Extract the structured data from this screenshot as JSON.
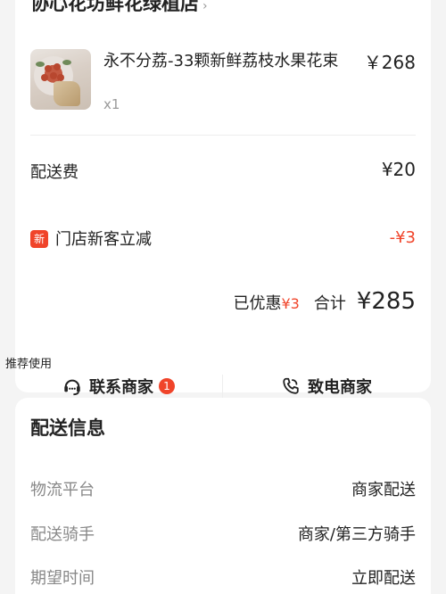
{
  "shop": {
    "name": "协心花坊鲜花绿植店",
    "chevron": "›"
  },
  "item": {
    "name": "永不分荔-33颗新鲜荔枝水果花束",
    "price": "￥268",
    "qty": "x1"
  },
  "fees": {
    "delivery_label": "配送费",
    "delivery_value": "¥20",
    "new_badge": "新",
    "discount_label": "门店新客立减",
    "discount_value": "-¥3"
  },
  "total": {
    "saved_label": "已优惠",
    "saved_value": "¥3",
    "sum_label": "合计",
    "sum_value": "¥285"
  },
  "actions": {
    "recommend_tag": "推荐使用",
    "contact_label": "联系商家",
    "contact_badge": "1",
    "call_label": "致电商家"
  },
  "delivery_info": {
    "title": "配送信息",
    "rows": [
      {
        "label": "物流平台",
        "value": "商家配送"
      },
      {
        "label": "配送骑手",
        "value": "商家/第三方骑手"
      },
      {
        "label": "期望时间",
        "value": "立即配送"
      }
    ]
  },
  "colors": {
    "accent": "#f0442a",
    "background": "#f4f4f4",
    "card": "#ffffff"
  },
  "icons": [
    "chat-headset-icon",
    "phone-icon",
    "chevron-down-icon"
  ]
}
